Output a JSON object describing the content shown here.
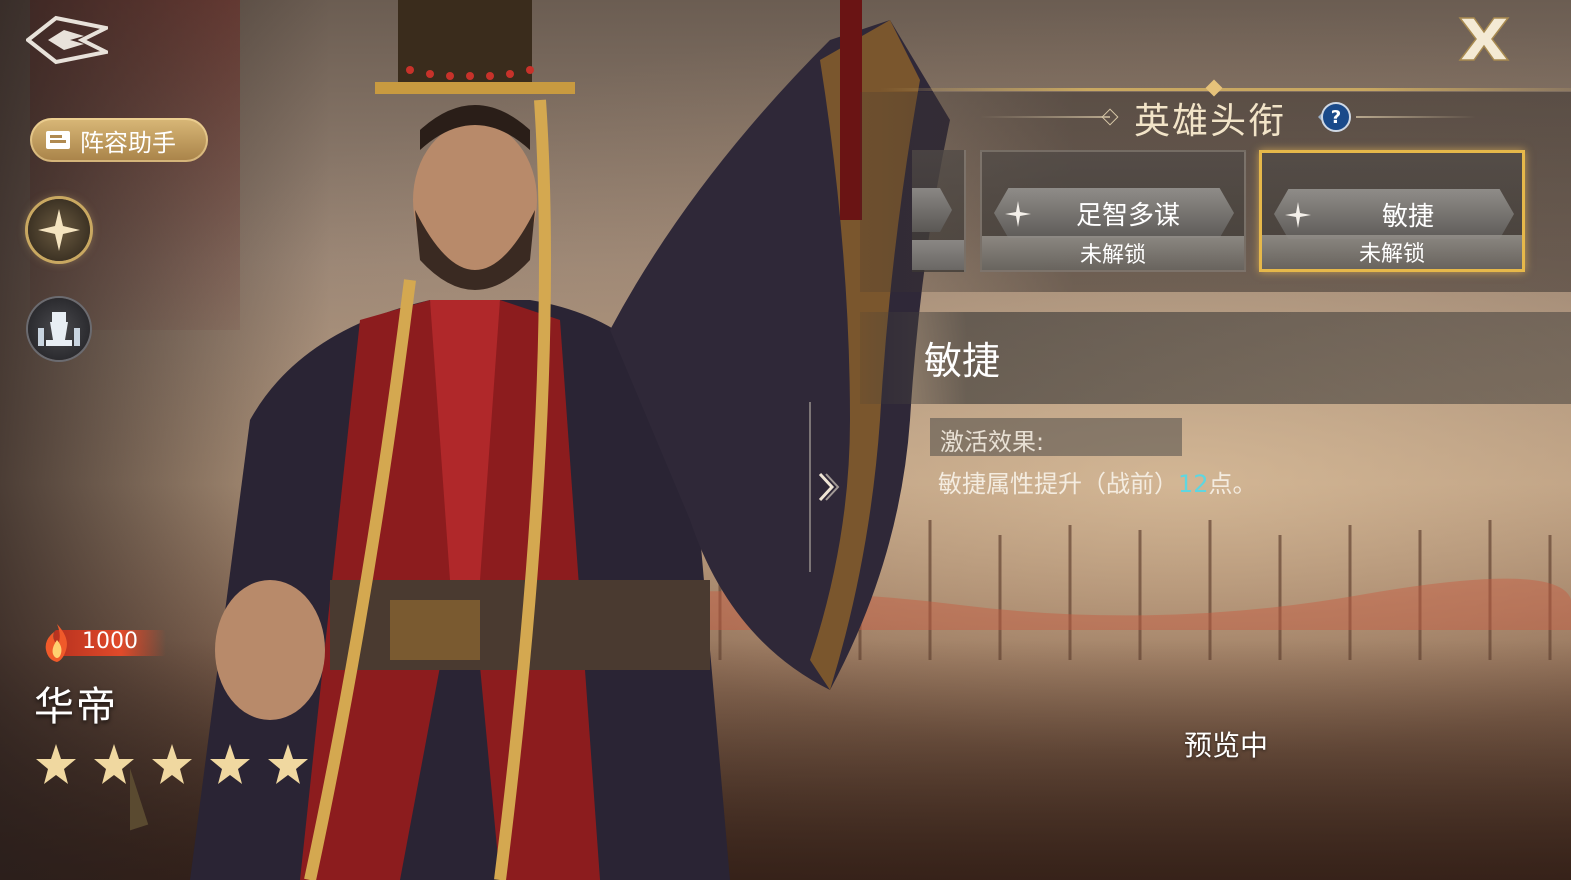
{
  "left_panel": {
    "helper_button_label": "阵容助手",
    "power_value": "1000",
    "hero_name": "华帝",
    "star_count": 5
  },
  "title_panel": {
    "title": "英雄头衔",
    "cards": [
      {
        "name": "足智多谋",
        "status": "未解锁",
        "selected": false
      },
      {
        "name": "敏捷",
        "status": "未解锁",
        "selected": true
      }
    ]
  },
  "detail": {
    "name": "敏捷",
    "effect_label": "激活效果:",
    "effect_prefix": "敏捷属性提升（战前）",
    "effect_value": "12",
    "effect_suffix": "点。"
  },
  "status": {
    "preview_label": "预览中"
  },
  "colors": {
    "accent_gold": "#e6b84a",
    "effect_value_color": "#5fd6e0",
    "power_bar": "#e04a2a"
  },
  "icons": [
    "back-arrow-icon",
    "book-icon",
    "star-compass-icon",
    "chess-icon",
    "close-icon",
    "help-icon",
    "flame-icon",
    "rating-star-icon",
    "collapse-arrow-icon"
  ]
}
